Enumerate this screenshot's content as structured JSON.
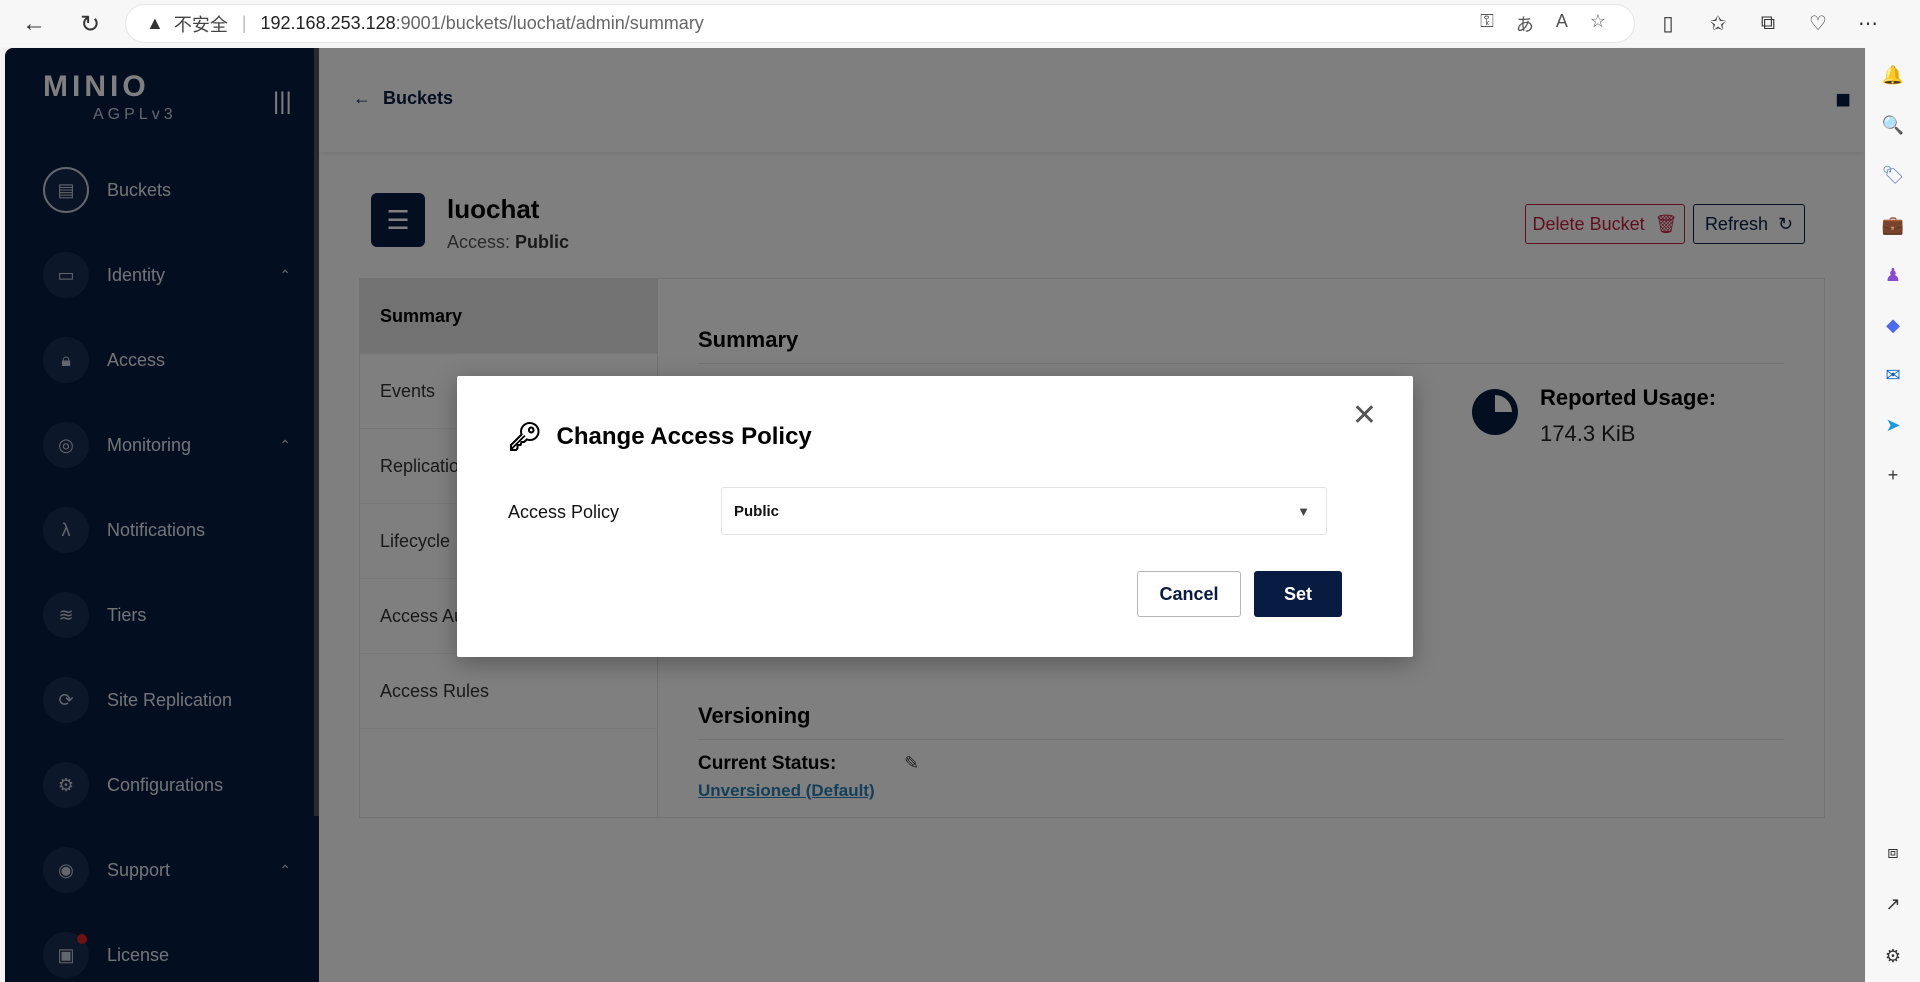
{
  "browser": {
    "security_label": "不安全",
    "url_host": "192.168.253.128",
    "url_path": ":9001/buckets/luochat/admin/summary"
  },
  "sidebar": {
    "logo": "MINIO",
    "license_tag": "AGPLv3",
    "items": [
      {
        "label": "Buckets"
      },
      {
        "label": "Identity"
      },
      {
        "label": "Access"
      },
      {
        "label": "Monitoring"
      },
      {
        "label": "Notifications"
      },
      {
        "label": "Tiers"
      },
      {
        "label": "Site Replication"
      },
      {
        "label": "Configurations"
      },
      {
        "label": "Support"
      },
      {
        "label": "License"
      }
    ]
  },
  "header": {
    "back_label": "Buckets"
  },
  "bucket": {
    "name": "luochat",
    "access_prefix": "Access: ",
    "access_value": "Public",
    "delete_label": "Delete Bucket",
    "refresh_label": "Refresh"
  },
  "tabs": [
    "Summary",
    "Events",
    "Replication",
    "Lifecycle",
    "Access Audit",
    "Access Rules"
  ],
  "summary": {
    "title": "Summary",
    "usage_label": "Reported Usage:",
    "usage_value": "174.3 KiB",
    "versioning_title": "Versioning",
    "current_status_label": "Current Status:",
    "current_status_value": "Unversioned (Default)"
  },
  "modal": {
    "title": "Change Access Policy",
    "field_label": "Access Policy",
    "selected_value": "Public",
    "cancel_label": "Cancel",
    "set_label": "Set"
  }
}
